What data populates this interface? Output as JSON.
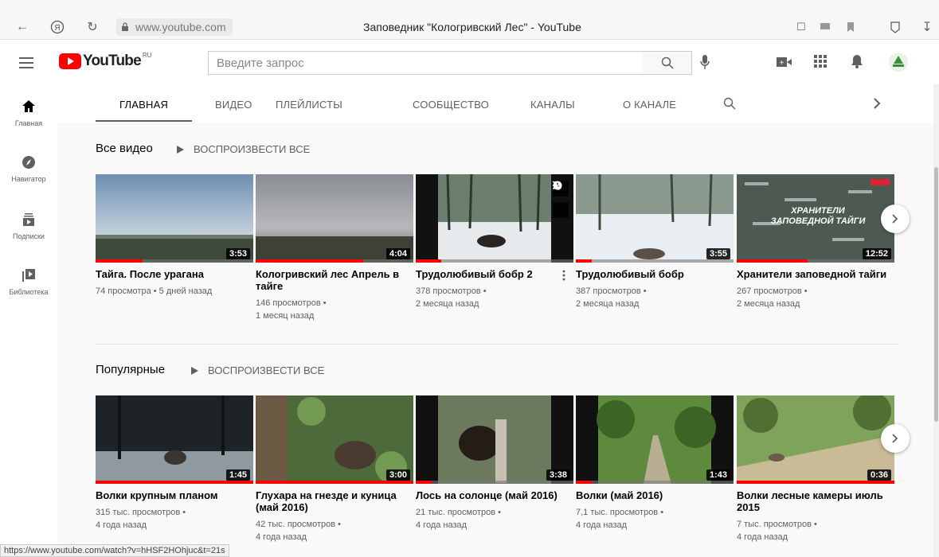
{
  "browser": {
    "url": "www.youtube.com",
    "title": "Заповедник \"Кологривский Лес\" - YouTube"
  },
  "masthead": {
    "logo_text": "YouTube",
    "logo_region": "RU",
    "search_placeholder": "Введите запрос"
  },
  "sidebar": {
    "items": [
      {
        "label": "Главная",
        "icon": "home-icon"
      },
      {
        "label": "Навигатор",
        "icon": "compass-icon"
      },
      {
        "label": "Подписки",
        "icon": "subscriptions-icon"
      },
      {
        "label": "Библиотека",
        "icon": "library-icon"
      }
    ]
  },
  "tabs": {
    "items": [
      "ГЛАВНАЯ",
      "ВИДЕО",
      "ПЛЕЙЛИСТЫ",
      "СООБЩЕСТВО",
      "КАНАЛЫ",
      "О КАНАЛЕ"
    ],
    "active": "ГЛАВНАЯ"
  },
  "sections": [
    {
      "title": "Все видео",
      "play_all": "ВОСПРОИЗВЕСТИ ВСЕ",
      "videos": [
        {
          "title": "Тайга. После урагана",
          "meta1": "74 просмотра • 5 дней назад",
          "meta2": "",
          "duration": "3:53",
          "progress": 0.3
        },
        {
          "title": "Кологривский лес Апрель в тайге",
          "meta1": "146 просмотров •",
          "meta2": "1 месяц назад",
          "duration": "4:04",
          "progress": 0.68
        },
        {
          "title": "Трудолюбивый бобр 2",
          "meta1": "378 просмотров •",
          "meta2": "2 месяца назад",
          "duration": "",
          "progress": 0.16
        },
        {
          "title": "Трудолюбивый бобр",
          "meta1": "387 просмотров •",
          "meta2": "2 месяца назад",
          "duration": "3:55",
          "progress": 0.1
        },
        {
          "title": "Хранители заповедной тайги",
          "meta1": "267 просмотров •",
          "meta2": "2 месяца назад",
          "duration": "12:52",
          "progress": 0.45
        }
      ]
    },
    {
      "title": "Популярные",
      "play_all": "ВОСПРОИЗВЕСТИ ВСЕ",
      "videos": [
        {
          "title": "Волки крупным планом",
          "meta1": "315 тыс. просмотров •",
          "meta2": "4 года назад",
          "duration": "1:45",
          "progress": 1.0
        },
        {
          "title": "Глухара на гнезде и куница (май 2016)",
          "meta1": "42 тыс. просмотров •",
          "meta2": "4 года назад",
          "duration": "3:00",
          "progress": 1.0
        },
        {
          "title": "Лось на солонце (май 2016)",
          "meta1": "21 тыс. просмотров •",
          "meta2": "4 года назад",
          "duration": "3:38",
          "progress": 0.1
        },
        {
          "title": "Волки (май 2016)",
          "meta1": "7,1 тыс. просмотров •",
          "meta2": "4 года назад",
          "duration": "1:43",
          "progress": 0.1
        },
        {
          "title": "Волки лесные камеры июль 2015",
          "meta1": "7 тыс. просмотров •",
          "meta2": "4 года назад",
          "duration": "0:36",
          "progress": 1.0
        }
      ]
    }
  ],
  "thumb_overlay_text": "ХРАНИТЕЛИ ЗАПОВЕДНОЙ ТАЙГИ",
  "status_url": "https://www.youtube.com/watch?v=hHSF2HOhjuc&t=21s"
}
